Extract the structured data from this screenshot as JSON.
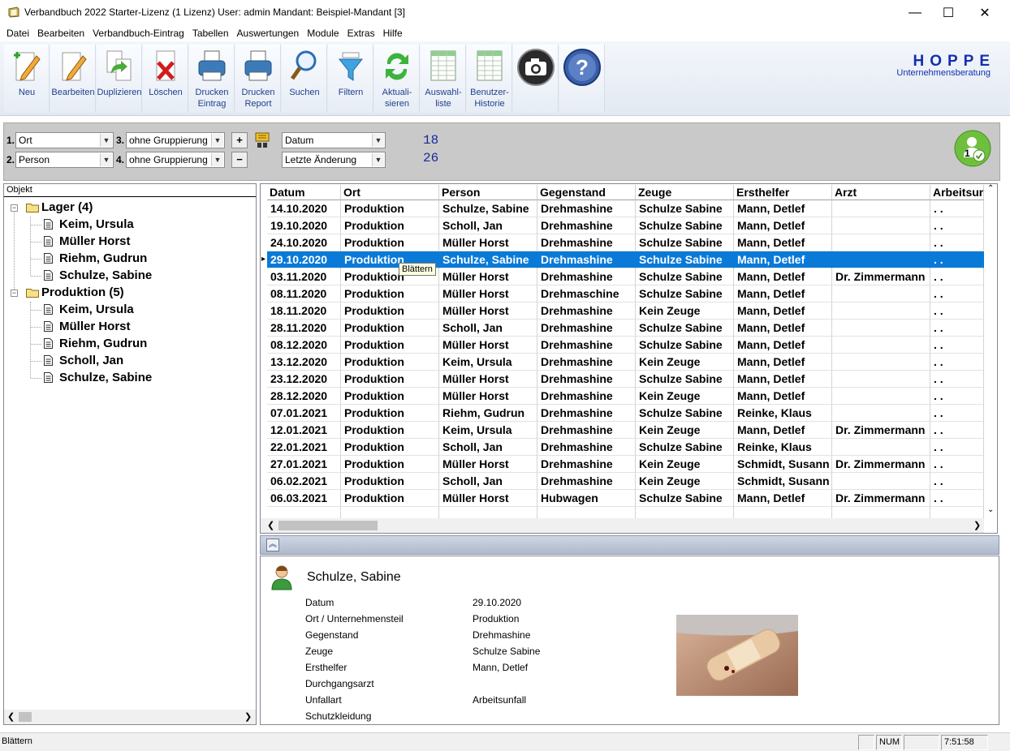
{
  "window": {
    "title": "Verbandbuch 2022 Starter-Lizenz (1 Lizenz)   User: admin Mandant: Beispiel-Mandant [3]",
    "minimize": "—",
    "maximize": "☐",
    "close": "✕"
  },
  "menu": [
    "Datei",
    "Bearbeiten",
    "Verbandbuch-Eintrag",
    "Tabellen",
    "Auswertungen",
    "Module",
    "Extras",
    "Hilfe"
  ],
  "toolbar": {
    "buttons": [
      {
        "label": "Neu",
        "icon": "new-entry-icon"
      },
      {
        "label": "Bearbeiten",
        "icon": "edit-icon"
      },
      {
        "label": "Duplizieren",
        "icon": "duplicate-icon"
      },
      {
        "label": "Löschen",
        "icon": "delete-icon"
      },
      {
        "label": "Drucken\nEintrag",
        "icon": "printer-icon"
      },
      {
        "label": "Drucken\nReport",
        "icon": "printer-icon"
      },
      {
        "label": "Suchen",
        "icon": "search-icon"
      },
      {
        "label": "Filtern",
        "icon": "filter-icon"
      },
      {
        "label": "Aktuali-\nsieren",
        "icon": "refresh-icon"
      },
      {
        "label": "Auswahl-\nliste",
        "icon": "list-icon"
      },
      {
        "label": "Benutzer-\nHistorie",
        "icon": "history-icon"
      },
      {
        "label": "",
        "icon": "camera-icon"
      },
      {
        "label": "",
        "icon": "help-icon"
      }
    ],
    "logo_title": "HOPPE",
    "logo_subtitle": "Unternehmensberatung"
  },
  "grouping": {
    "g1_num": "1.",
    "g1_value": "Ort",
    "g2_num": "2.",
    "g2_value": "Person",
    "g3_num": "3.",
    "g3_value": "ohne Gruppierung",
    "g4_num": "4.",
    "g4_value": "ohne Gruppierung",
    "plus": "+",
    "minus": "−",
    "sort1": "Datum",
    "sort2": "Letzte Änderung",
    "count1": "18",
    "count2": "26",
    "user_badge": "1"
  },
  "tree": {
    "header": "Objekt",
    "groups": [
      {
        "label": "Lager  (4)",
        "expander": "−",
        "children": [
          "Keim, Ursula",
          "Müller Horst",
          "Riehm, Gudrun",
          "Schulze, Sabine"
        ]
      },
      {
        "label": "Produktion  (5)",
        "expander": "−",
        "children": [
          "Keim, Ursula",
          "Müller Horst",
          "Riehm, Gudrun",
          "Scholl, Jan",
          "Schulze, Sabine"
        ]
      }
    ]
  },
  "grid": {
    "columns": [
      "Datum",
      "Ort",
      "Person",
      "Gegenstand",
      "Zeuge",
      "Ersthelfer",
      "Arzt",
      "Arbeitsunfall"
    ],
    "selected_index": 3,
    "rows": [
      [
        "14.10.2020",
        "Produktion",
        "Schulze, Sabine",
        "Drehmashine",
        "Schulze Sabine",
        "Mann, Detlef",
        "",
        ". ."
      ],
      [
        "19.10.2020",
        "Produktion",
        "Scholl, Jan",
        "Drehmashine",
        "Schulze Sabine",
        "Mann, Detlef",
        "",
        ". ."
      ],
      [
        "24.10.2020",
        "Produktion",
        "Müller Horst",
        "Drehmashine",
        "Schulze Sabine",
        "Mann, Detlef",
        "",
        ". ."
      ],
      [
        "29.10.2020",
        "Produktion",
        "Schulze, Sabine",
        "Drehmashine",
        "Schulze Sabine",
        "Mann, Detlef",
        "",
        ". ."
      ],
      [
        "03.11.2020",
        "Produktion",
        "Müller Horst",
        "Drehmashine",
        "Schulze Sabine",
        "Mann, Detlef",
        "Dr. Zimmermann",
        ". ."
      ],
      [
        "08.11.2020",
        "Produktion",
        "Müller Horst",
        "Drehmaschine",
        "Schulze Sabine",
        "Mann, Detlef",
        "",
        ". ."
      ],
      [
        "18.11.2020",
        "Produktion",
        "Müller Horst",
        "Drehmashine",
        "Kein Zeuge",
        "Mann, Detlef",
        "",
        ". ."
      ],
      [
        "28.11.2020",
        "Produktion",
        "Scholl, Jan",
        "Drehmashine",
        "Schulze Sabine",
        "Mann, Detlef",
        "",
        ". ."
      ],
      [
        "08.12.2020",
        "Produktion",
        "Müller Horst",
        "Drehmashine",
        "Schulze Sabine",
        "Mann, Detlef",
        "",
        ". ."
      ],
      [
        "13.12.2020",
        "Produktion",
        "Keim, Ursula",
        "Drehmashine",
        "Kein Zeuge",
        "Mann, Detlef",
        "",
        ". ."
      ],
      [
        "23.12.2020",
        "Produktion",
        "Müller Horst",
        "Drehmashine",
        "Schulze Sabine",
        "Mann, Detlef",
        "",
        ". ."
      ],
      [
        "28.12.2020",
        "Produktion",
        "Müller Horst",
        "Drehmashine",
        "Kein Zeuge",
        "Mann, Detlef",
        "",
        ". ."
      ],
      [
        "07.01.2021",
        "Produktion",
        "Riehm, Gudrun",
        "Drehmashine",
        "Schulze Sabine",
        "Reinke, Klaus",
        "",
        ". ."
      ],
      [
        "12.01.2021",
        "Produktion",
        "Keim, Ursula",
        "Drehmashine",
        "Kein Zeuge",
        "Mann, Detlef",
        "Dr. Zimmermann",
        ". ."
      ],
      [
        "22.01.2021",
        "Produktion",
        "Scholl, Jan",
        "Drehmashine",
        "Schulze Sabine",
        "Reinke, Klaus",
        "",
        ". ."
      ],
      [
        "27.01.2021",
        "Produktion",
        "Müller Horst",
        "Drehmashine",
        "Kein Zeuge",
        "Schmidt, Susann",
        "Dr. Zimmermann",
        ". ."
      ],
      [
        "06.02.2021",
        "Produktion",
        "Scholl, Jan",
        "Drehmashine",
        "Kein Zeuge",
        "Schmidt, Susann",
        "",
        ". ."
      ],
      [
        "06.03.2021",
        "Produktion",
        "Müller Horst",
        "Hubwagen",
        "Schulze Sabine",
        "Mann, Detlef",
        "Dr. Zimmermann",
        ". ."
      ]
    ],
    "tooltip": "Blättern",
    "row_pointer": "▸"
  },
  "detail": {
    "name": "Schulze, Sabine",
    "fields": [
      {
        "label": "Datum",
        "value": "29.10.2020"
      },
      {
        "label": "Ort / Unternehmensteil",
        "value": "Produktion"
      },
      {
        "label": "Gegenstand",
        "value": "Drehmashine"
      },
      {
        "label": "Zeuge",
        "value": "Schulze Sabine"
      },
      {
        "label": "Ersthelfer",
        "value": "Mann, Detlef"
      },
      {
        "label": "Durchgangsarzt",
        "value": ""
      },
      {
        "label": "Unfallart",
        "value": "Arbeitsunfall"
      },
      {
        "label": "Schutzkleidung",
        "value": ""
      }
    ],
    "image_icon": "bandage-photo-icon"
  },
  "statusbar": {
    "text": "Blättern",
    "num": "NUM",
    "time": "7:51:58"
  },
  "colors": {
    "selection": "#0a7ad8",
    "toolbar_label": "#1f3f8f",
    "logo": "#1230b0",
    "count": "#1a2a9c"
  }
}
